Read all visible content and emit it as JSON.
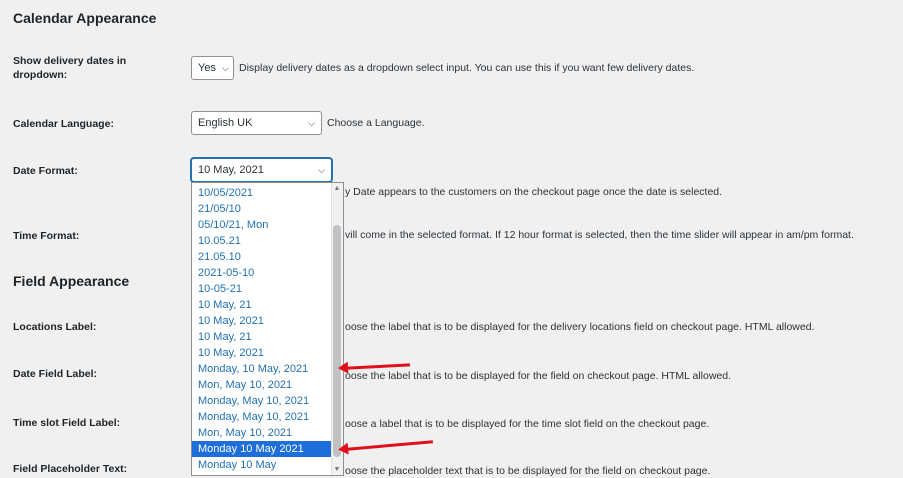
{
  "calendar": {
    "title": "Calendar Appearance",
    "show_dropdown": {
      "label": "Show delivery dates in dropdown:",
      "value": "Yes",
      "desc": "Display delivery dates as a dropdown select input. You can use this if you want few delivery dates."
    },
    "language": {
      "label": "Calendar Language:",
      "value": "English UK",
      "desc": "Choose a Language."
    },
    "date_format": {
      "label": "Date Format:",
      "value": "10 May, 2021",
      "desc_partial": "y Date appears to the customers on the checkout page once the date is selected."
    },
    "time_format": {
      "label": "Time Format:",
      "desc_partial": "vill come in the selected format. If 12 hour format is selected, then the time slider will appear in am/pm format."
    }
  },
  "field": {
    "title": "Field Appearance",
    "locations_label": {
      "label": "Locations Label:",
      "desc_partial": "oose the label that is to be displayed for the delivery locations field on checkout page. HTML allowed."
    },
    "date_field_label": {
      "label": "Date Field Label:",
      "desc_partial": "oose the label that is to be displayed for the field on checkout page. HTML allowed."
    },
    "time_slot_label": {
      "label": "Time slot Field Label:",
      "desc_partial": "oose a label that is to be displayed for the time slot field on the checkout page."
    },
    "placeholder_text": {
      "label": "Field Placeholder Text:",
      "desc_partial": "oose the placeholder text that is to be displayed for the field on checkout page."
    }
  },
  "date_options": [
    "10/05/2021",
    "21/05/10",
    "05/10/21, Mon",
    "10.05.21",
    "21.05.10",
    "2021-05-10",
    "10-05-21",
    "10 May, 21",
    "10 May, 2021",
    "10 May, 21",
    "10 May, 2021",
    "Monday, 10 May, 2021",
    "Mon, May 10, 2021",
    "Monday, May 10, 2021",
    "Monday, May 10, 2021",
    "Mon, May 10, 2021",
    "Monday 10 May 2021",
    "Monday 10 May"
  ],
  "selected_option_index": 16,
  "icons": {
    "chevron": "chevron-down-icon",
    "arrow": "red-arrow-annotation"
  },
  "colors": {
    "accent": "#2271b1",
    "highlight": "#1e6fd9",
    "annotation": "#e0101a",
    "background": "#f0f0f1"
  }
}
